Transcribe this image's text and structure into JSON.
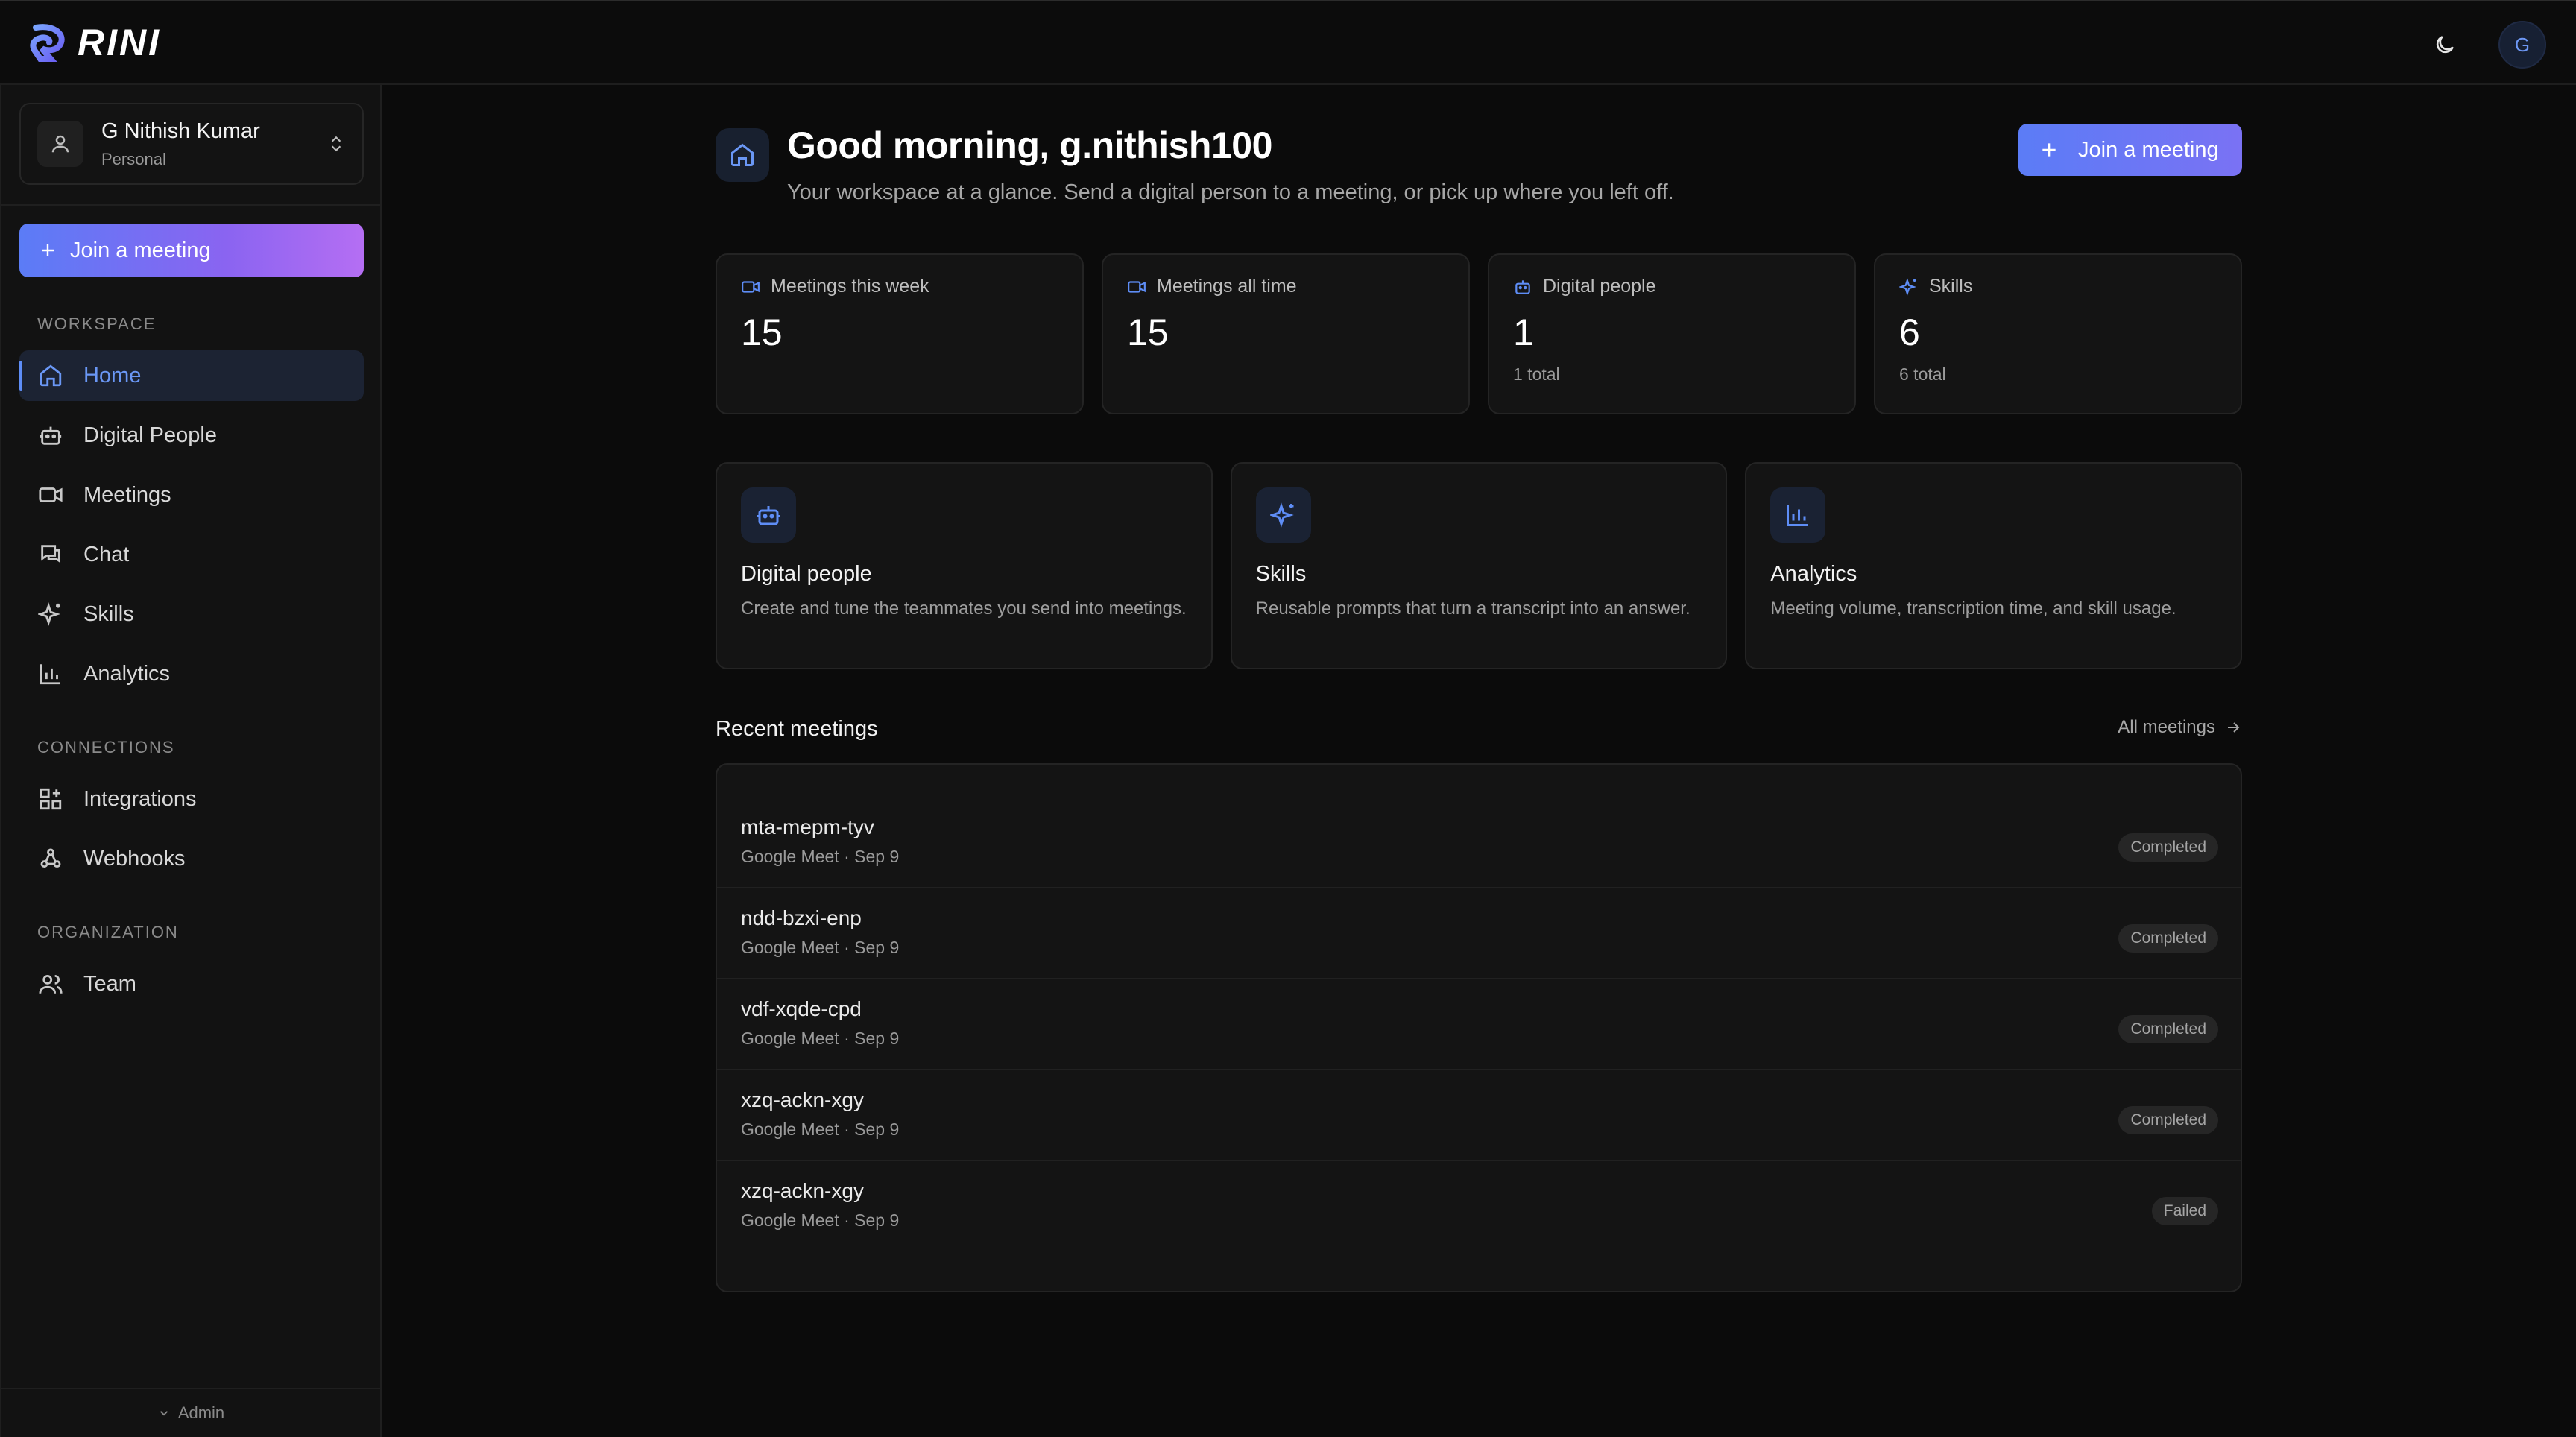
{
  "brand": {
    "name": "RINI"
  },
  "topbar": {
    "avatar_initial": "G"
  },
  "account": {
    "name": "G Nithish Kumar",
    "type": "Personal"
  },
  "sidebar": {
    "join_label": "Join a meeting",
    "workspace_label": "WORKSPACE",
    "workspace_items": [
      {
        "label": "Home",
        "icon": "home-icon"
      },
      {
        "label": "Digital People",
        "icon": "bot-icon"
      },
      {
        "label": "Meetings",
        "icon": "video-icon"
      },
      {
        "label": "Chat",
        "icon": "chat-icon"
      },
      {
        "label": "Skills",
        "icon": "sparkles-icon"
      },
      {
        "label": "Analytics",
        "icon": "chart-icon"
      }
    ],
    "connections_label": "CONNECTIONS",
    "connections_items": [
      {
        "label": "Integrations",
        "icon": "grid-plus-icon"
      },
      {
        "label": "Webhooks",
        "icon": "webhook-icon"
      }
    ],
    "organization_label": "ORGANIZATION",
    "organization_items": [
      {
        "label": "Team",
        "icon": "users-icon"
      }
    ],
    "admin_label": "Admin"
  },
  "header": {
    "greeting": "Good morning, g.nithish100",
    "subtitle": "Your workspace at a glance. Send a digital person to a meeting, or pick up where you left off.",
    "join_label": "Join a meeting"
  },
  "stats": [
    {
      "label": "Meetings this week",
      "value": "15",
      "sub": ""
    },
    {
      "label": "Meetings all time",
      "value": "15",
      "sub": ""
    },
    {
      "label": "Digital people",
      "value": "1",
      "sub": "1 total"
    },
    {
      "label": "Skills",
      "value": "6",
      "sub": "6 total"
    }
  ],
  "features": [
    {
      "title": "Digital people",
      "desc": "Create and tune the teammates you send into meetings."
    },
    {
      "title": "Skills",
      "desc": "Reusable prompts that turn a transcript into an answer."
    },
    {
      "title": "Analytics",
      "desc": "Meeting volume, transcription time, and skill usage."
    }
  ],
  "recent": {
    "title": "Recent meetings",
    "all_label": "All meetings",
    "rows": [
      {
        "name": "mta-mepm-tyv",
        "meta": "Google Meet · Sep 9",
        "status": "Completed"
      },
      {
        "name": "ndd-bzxi-enp",
        "meta": "Google Meet · Sep 9",
        "status": "Completed"
      },
      {
        "name": "vdf-xqde-cpd",
        "meta": "Google Meet · Sep 9",
        "status": "Completed"
      },
      {
        "name": "xzq-ackn-xgy",
        "meta": "Google Meet · Sep 9",
        "status": "Completed"
      },
      {
        "name": "xzq-ackn-xgy",
        "meta": "Google Meet · Sep 9",
        "status": "Failed"
      }
    ]
  },
  "colors": {
    "accent": "#5e8df6",
    "gradient_end": "#b56ef3",
    "background": "#0b0b0b"
  }
}
